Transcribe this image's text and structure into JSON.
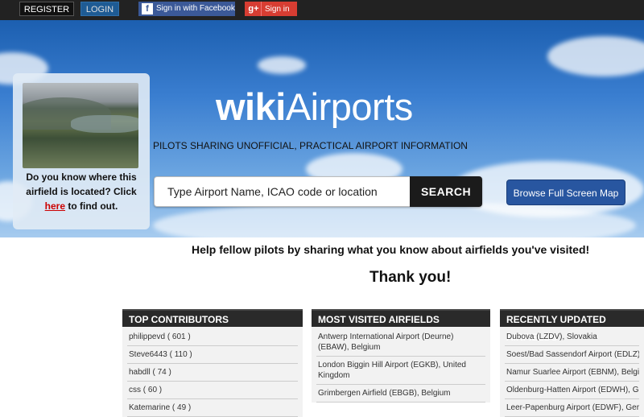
{
  "topbar": {
    "register": "REGISTER",
    "login": "LOGIN",
    "facebook": "Sign in with Facebook",
    "facebook_icon": "f",
    "google": "Sign in",
    "google_icon": "g+"
  },
  "hero": {
    "logo_bold": "wiki",
    "logo_light": "Airports",
    "tagline": "PILOTS SHARING UNOFFICIAL, PRACTICAL AIRPORT INFORMATION",
    "search_placeholder": "Type Airport Name, ICAO code or location",
    "search_button": "SEARCH",
    "map_button": "Browse Full Screen Map",
    "quiz_text_1": "Do you know where this airfield is located? Click",
    "quiz_link": "here",
    "quiz_text_2": "to find out."
  },
  "main": {
    "help_text": "Help fellow pilots by sharing what you know about airfields you've visited!",
    "thanks": "Thank you!"
  },
  "contributors": {
    "title": "TOP CONTRIBUTORS",
    "items": [
      "philippevd ( 601 )",
      "Steve6443 ( 110 )",
      "habdll ( 74 )",
      "css ( 60 )",
      "Katemarine ( 49 )"
    ]
  },
  "most_visited": {
    "title": "MOST VISITED AIRFIELDS",
    "items": [
      "Antwerp International Airport (Deurne) (EBAW), Belgium",
      "London Biggin Hill Airport (EGKB), United Kingdom",
      "Grimbergen Airfield (EBGB), Belgium"
    ]
  },
  "recent": {
    "title": "RECENTLY UPDATED AIRFIELDS",
    "items": [
      "Dubova (LZDV), Slovakia",
      "Soest/Bad Sassendorf Airport (EDLZ), Germany",
      "Namur Suarlee Airport (EBNM), Belgium",
      "Oldenburg-Hatten Airport (EDWH), Germany",
      "Leer-Papenburg Airport (EDWF), Germany"
    ]
  }
}
